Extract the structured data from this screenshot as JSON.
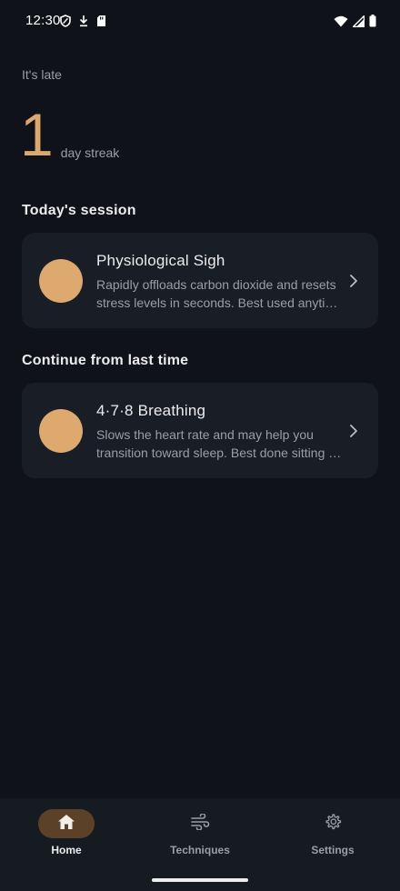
{
  "status_bar": {
    "time": "12:30",
    "left_icons": [
      "shield-icon",
      "download-icon",
      "sd-card-icon"
    ],
    "right_icons": [
      "wifi-icon",
      "cell-signal-icon",
      "battery-icon"
    ]
  },
  "header": {
    "greeting": "It's late",
    "streak_count": "1",
    "streak_label": "day streak"
  },
  "sections": {
    "today_title": "Today's session",
    "continue_title": "Continue from last time"
  },
  "cards": [
    {
      "title": "Physiological Sigh",
      "description": "Rapidly offloads carbon dioxide and resets stress levels in seconds. Best used anytime you feel overwhelmed.",
      "avatar_color": "#dda96f"
    },
    {
      "title": "4·7·8 Breathing",
      "description": "Slows the heart rate and may help you transition toward sleep. Best done sitting or lying down.",
      "avatar_color": "#dda96f"
    }
  ],
  "bottom_nav": {
    "items": [
      {
        "label": "Home",
        "icon": "home-icon",
        "active": true
      },
      {
        "label": "Techniques",
        "icon": "wind-icon",
        "active": false
      },
      {
        "label": "Settings",
        "icon": "gear-icon",
        "active": false
      }
    ]
  },
  "colors": {
    "background": "#0f1218",
    "card": "#191d25",
    "accent": "#dba870",
    "nav_active_pill": "#5a4128"
  }
}
